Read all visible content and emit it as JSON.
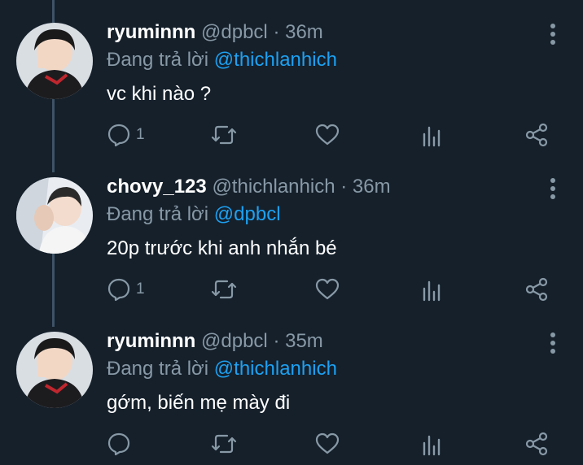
{
  "colors": {
    "background": "#15202b",
    "primary_text": "#ffffff",
    "secondary_text": "#8899a6",
    "link": "#1da1f2",
    "thread_line": "#3d5466"
  },
  "tweets": [
    {
      "author_name": "ryuminnn",
      "handle": "@dpbcl",
      "separator": "·",
      "time": "36m",
      "replying_prefix": "Đang trả lời",
      "replying_to": "@thichlanhich",
      "text": "vc khi nào ?",
      "reply_count": "1",
      "avatar_icon": "avatar-dark-photo"
    },
    {
      "author_name": "chovy_123",
      "handle": "@thichlanhich",
      "separator": "·",
      "time": "36m",
      "replying_prefix": "Đang trả lời",
      "replying_to": "@dpbcl",
      "text": "20p trước khi anh nhắn bé",
      "reply_count": "1",
      "avatar_icon": "avatar-light-photo"
    },
    {
      "author_name": "ryuminnn",
      "handle": "@dpbcl",
      "separator": "·",
      "time": "35m",
      "replying_prefix": "Đang trả lời",
      "replying_to": "@thichlanhich",
      "text": "gớm, biến mẹ mày đi",
      "reply_count": "",
      "avatar_icon": "avatar-dark-photo"
    }
  ],
  "icons": [
    "reply-icon",
    "retweet-icon",
    "like-icon",
    "analytics-icon",
    "share-icon",
    "more-options-icon"
  ]
}
